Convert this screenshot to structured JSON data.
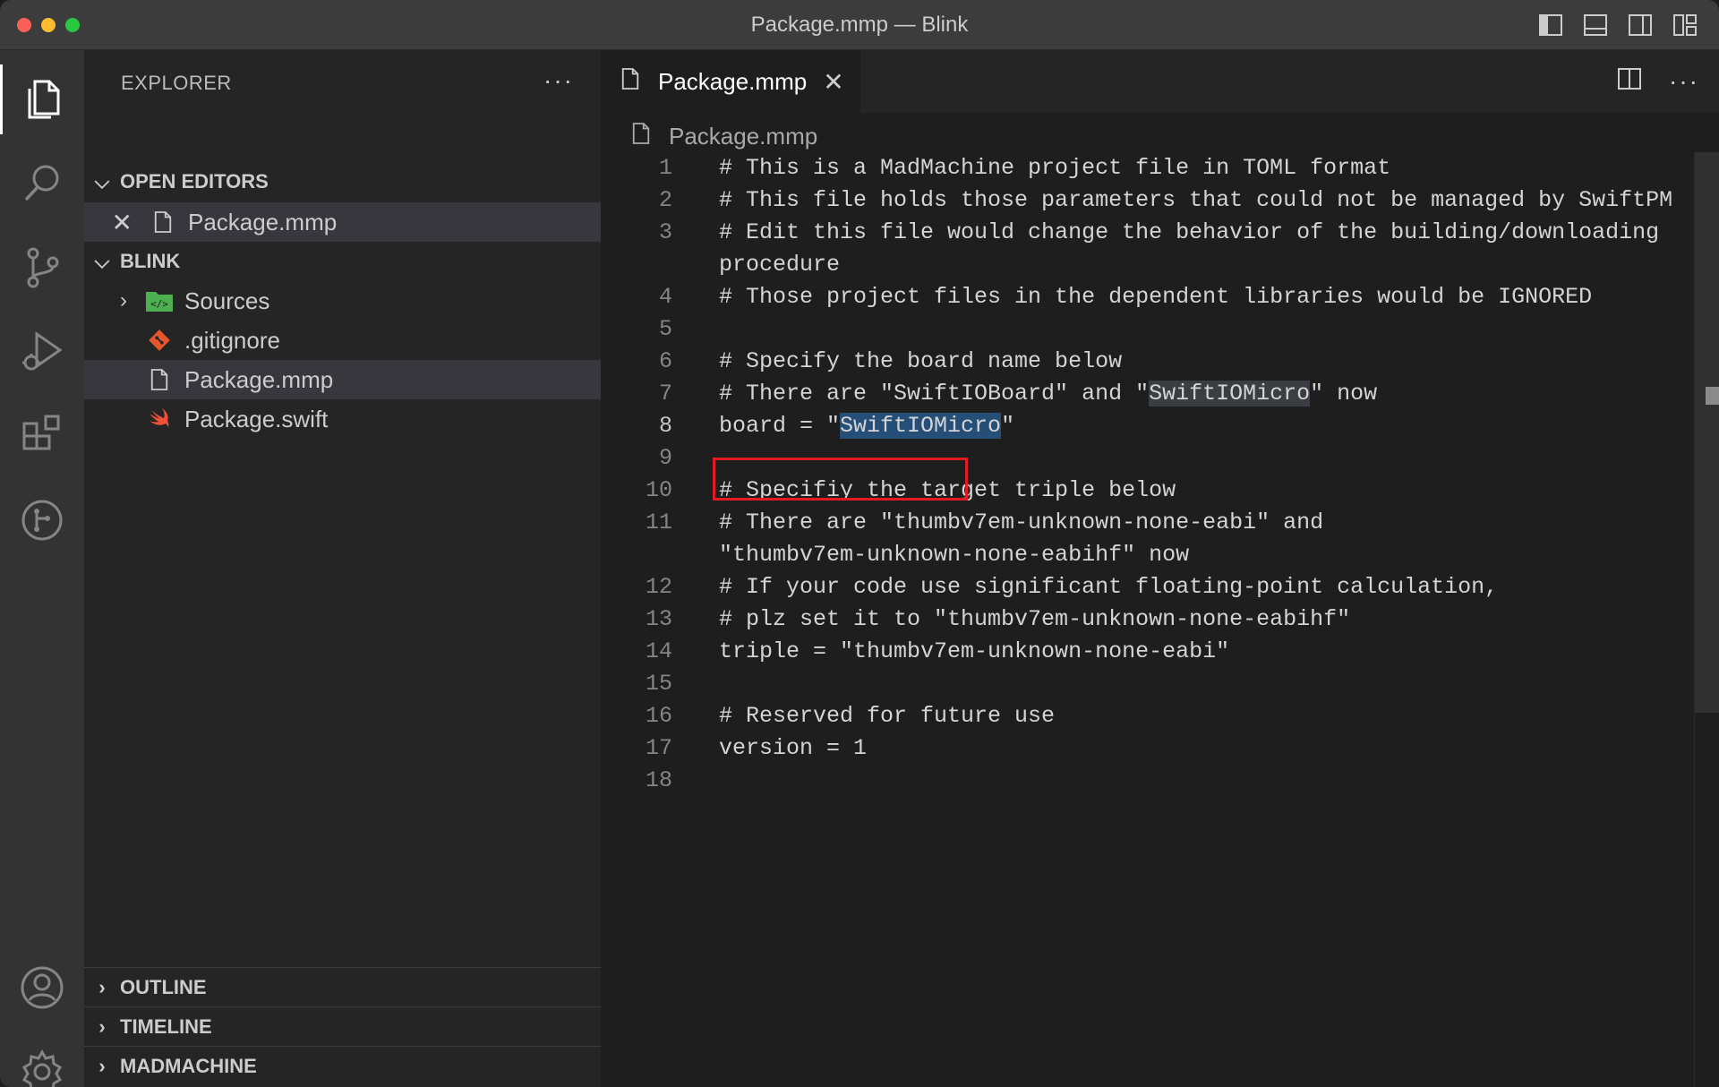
{
  "window": {
    "title": "Package.mmp — Blink"
  },
  "sidebar": {
    "header": "EXPLORER",
    "open_editors": {
      "label": "OPEN EDITORS",
      "items": [
        {
          "name": "Package.mmp"
        }
      ]
    },
    "project": {
      "label": "BLINK",
      "items": [
        {
          "name": "Sources",
          "icon": "folder-source-icon"
        },
        {
          "name": ".gitignore",
          "icon": "git-icon"
        },
        {
          "name": "Package.mmp",
          "icon": "file-icon"
        },
        {
          "name": "Package.swift",
          "icon": "swift-icon"
        }
      ]
    },
    "bottom_sections": [
      "OUTLINE",
      "TIMELINE",
      "MADMACHINE"
    ]
  },
  "editor": {
    "tab": {
      "label": "Package.mmp"
    },
    "breadcrumb": "Package.mmp",
    "lines": [
      {
        "n": "1",
        "text": "# This is a MadMachine project file in TOML format"
      },
      {
        "n": "2",
        "text": "# This file holds those parameters that could not be managed by SwiftPM"
      },
      {
        "n": "3",
        "text": "# Edit this file would change the behavior of the building/downloading"
      },
      {
        "n": "",
        "text": "procedure"
      },
      {
        "n": "4",
        "text": "# Those project files in the dependent libraries would be IGNORED"
      },
      {
        "n": "5",
        "text": ""
      },
      {
        "n": "6",
        "text": "# Specify the board name below"
      },
      {
        "n": "7",
        "pre": "# There are \"SwiftIOBoard\" and \"",
        "mark": "SwiftIOMicro",
        "post": "\" now"
      },
      {
        "n": "8",
        "pre": "board = \"",
        "sel": "SwiftIOMicro",
        "post": "\""
      },
      {
        "n": "9",
        "text": ""
      },
      {
        "n": "10",
        "text": "# Specifiy the target triple below"
      },
      {
        "n": "11",
        "text": "# There are \"thumbv7em-unknown-none-eabi\" and"
      },
      {
        "n": "",
        "text": "\"thumbv7em-unknown-none-eabihf\" now"
      },
      {
        "n": "12",
        "text": "# If your code use significant floating-point calculation,"
      },
      {
        "n": "13",
        "text": "# plz set it to \"thumbv7em-unknown-none-eabihf\""
      },
      {
        "n": "14",
        "text": "triple = \"thumbv7em-unknown-none-eabi\""
      },
      {
        "n": "15",
        "text": ""
      },
      {
        "n": "16",
        "text": "# Reserved for future use"
      },
      {
        "n": "17",
        "text": "version = 1"
      },
      {
        "n": "18",
        "text": ""
      }
    ]
  },
  "colors": {
    "accent_box": "#e01b24",
    "selection": "#264f78"
  }
}
